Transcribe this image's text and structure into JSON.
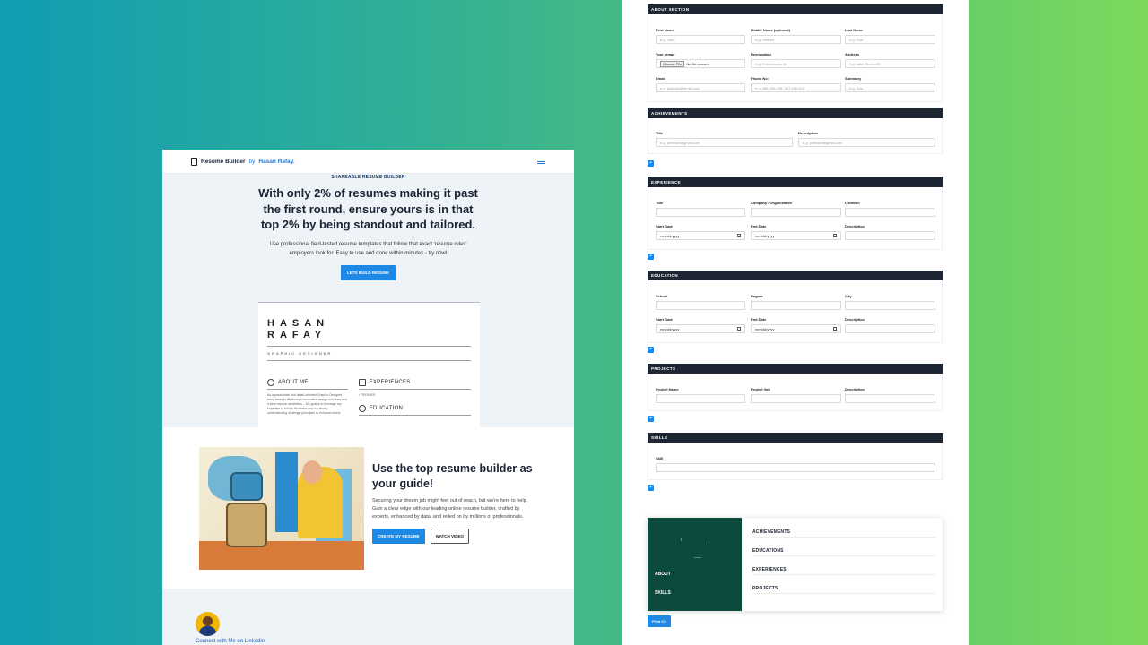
{
  "left": {
    "brand": {
      "name": "Resume Builder",
      "by": "by",
      "author": "Hasan Rafay."
    },
    "hero": {
      "eyebrow": "SHAREABLE RESUME BUILDER",
      "title": "With only 2% of resumes making it past the first round, ensure yours is in that top 2% by being standout and tailored.",
      "desc": "Use professional field-tested resume templates that follow that exact 'resume rules' employers look for. Easy to use and done within minutes - try now!",
      "cta": "LETS BUILD RESUME"
    },
    "cv": {
      "name1": "HASAN",
      "name2": "RAFAY",
      "role": "GRAPHIC DESIGNER",
      "about": "ABOUT ME",
      "about_text": "As a passionate and detail-oriented Graphic Designer, I bring ideas to life through innovative design solutions and a keen eye for aesthetics... My goal is to leverage my expertise in Adobe Illustrator and my strong understanding of design principles to enhance brand",
      "experiences": "EXPERIENCES",
      "fresher": "• FRESHER",
      "education": "EDUCATION"
    },
    "feature": {
      "title": "Use the top resume builder as your guide!",
      "desc": "Securing your dream job might feel out of reach, but we're here to help. Gain a clear edge with our leading online resume builder, crafted by experts, enhanced by data, and relied on by millions of professionals.",
      "create": "CREATE MY RESUME",
      "watch": "WATCH VIDEO"
    },
    "footer": {
      "connect": "Connect with Me on Linkedin"
    }
  },
  "right": {
    "about": {
      "title": "ABOUT SECTION",
      "first_name": {
        "label": "First Name",
        "placeholder": "e.g. John"
      },
      "middle_name": {
        "label": "Middle Name (optional)",
        "placeholder": "e.g. Herbert"
      },
      "last_name": {
        "label": "Last Name",
        "placeholder": "e.g. Doe"
      },
      "image": {
        "label": "Your Image",
        "button": "Choose File",
        "status": "No file chosen"
      },
      "designation": {
        "label": "Designation",
        "placeholder": "e.g. Sr.Accountants"
      },
      "address": {
        "label": "Address",
        "placeholder": "e.g. Lake Street-23"
      },
      "email": {
        "label": "Email",
        "placeholder": "e.g. johndoe@gmail.com"
      },
      "phone": {
        "label": "Phone No:",
        "placeholder": "e.g. 456-768-798, 567.654.002"
      },
      "summary": {
        "label": "Summary",
        "placeholder": "e.g. Doe"
      }
    },
    "achievements": {
      "title": "ACHIEVEMENTS",
      "f1": {
        "label": "Title",
        "placeholder": "e.g. johndoe@gmail.com"
      },
      "f2": {
        "label": "Description",
        "placeholder": "e.g. johndoe@gmail.com"
      }
    },
    "experience": {
      "title": "EXPERIENCE",
      "f1": "Title",
      "f2": "Company / Organization",
      "f3": "Location",
      "f4": "Start Date",
      "f5": "End Date",
      "f6": "Description",
      "date_placeholder": "mm/dd/yyyy"
    },
    "education": {
      "title": "EDUCATION",
      "f1": "School",
      "f2": "Degree",
      "f3": "City",
      "f4": "Start Date",
      "f5": "End Date",
      "f6": "Description",
      "date_placeholder": "mm/dd/yyyy"
    },
    "projects": {
      "title": "PROJECTS",
      "f1": "Project Name",
      "f2": "Project link",
      "f3": "Description"
    },
    "skills": {
      "title": "SKILLS",
      "f1": "Skill"
    },
    "add_label": "+",
    "preview": {
      "about": "ABOUT",
      "skills": "SKILLS",
      "achievements": "ACHIEVEMENTS",
      "educations": "EDUCATIONS",
      "experiences": "EXPERIENCES",
      "projects": "PROJECTS"
    },
    "print": "Print CV"
  }
}
